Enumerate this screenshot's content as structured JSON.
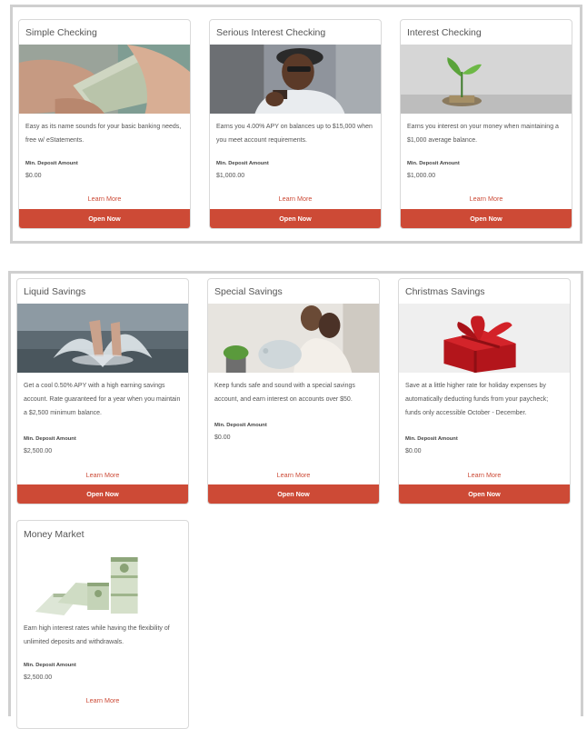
{
  "checking": [
    {
      "title": "Simple Checking",
      "image": "hands-counting-cash-image",
      "description": "Easy as its name sounds for your basic banking needs, free w/ eStatements.",
      "min_label": "Min. Deposit Amount",
      "min_value": "$0.00",
      "learn_more": "Learn More",
      "open_now": "Open Now"
    },
    {
      "title": "Serious Interest Checking",
      "image": "man-with-phone-image",
      "description": "Earns you 4.00% APY on balances up to $15,000 when you meet account requirements.",
      "min_label": "Min. Deposit Amount",
      "min_value": "$1,000.00",
      "learn_more": "Learn More",
      "open_now": "Open Now"
    },
    {
      "title": "Interest Checking",
      "image": "plant-sprout-coins-image",
      "description": "Earns you interest on your money when maintaining a $1,000 average balance.",
      "min_label": "Min. Deposit Amount",
      "min_value": "$1,000.00",
      "learn_more": "Learn More",
      "open_now": "Open Now"
    }
  ],
  "savings": [
    {
      "title": "Liquid Savings",
      "image": "water-splash-feet-image",
      "description": "Get a cool 0.50% APY with a high earning savings account. Rate guaranteed for a year when you maintain a $2,500 minimum balance.",
      "min_label": "Min. Deposit Amount",
      "min_value": "$2,500.00",
      "learn_more": "Learn More",
      "open_now": "Open Now"
    },
    {
      "title": "Special Savings",
      "image": "couple-piggy-bank-image",
      "description": "Keep funds safe and sound with a special savings account, and earn interest on accounts over $50.",
      "min_label": "Min. Deposit Amount",
      "min_value": "$0.00",
      "learn_more": "Learn More",
      "open_now": "Open Now"
    },
    {
      "title": "Christmas Savings",
      "image": "red-gift-box-image",
      "description": "Save at a little higher rate for holiday expenses by automatically deducting funds from your paycheck; funds only accessible October - December.",
      "min_label": "Min. Deposit Amount",
      "min_value": "$0.00",
      "learn_more": "Learn More",
      "open_now": "Open Now"
    },
    {
      "title": "Money Market",
      "image": "stacks-of-cash-image",
      "description": "Earn high interest rates while having the flexibility of unlimited deposits and withdrawals.",
      "min_label": "Min. Deposit Amount",
      "min_value": "$2,500.00",
      "learn_more": "Learn More"
    }
  ],
  "colors": {
    "accent": "#cd4a36",
    "panel_border": "#cfcfcf"
  }
}
